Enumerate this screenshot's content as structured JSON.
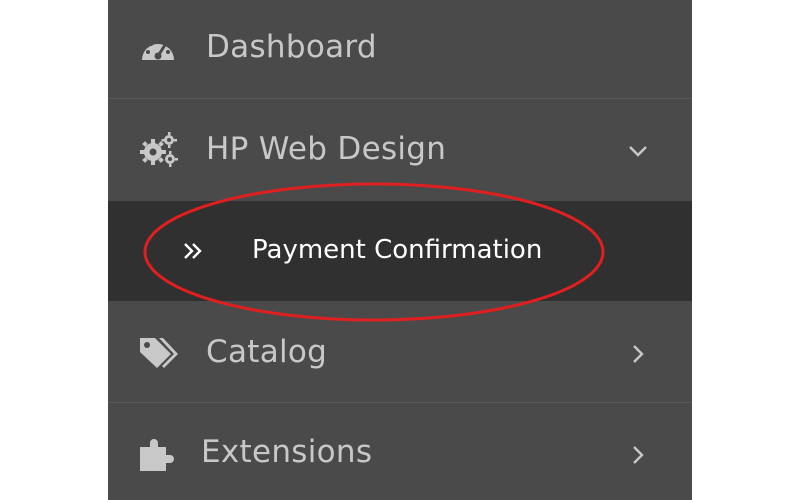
{
  "sidebar": {
    "items": [
      {
        "label": "Dashboard",
        "icon": "dashboard-gauge-icon",
        "expandable": false
      },
      {
        "label": "HP Web Design",
        "icon": "cogs-icon",
        "expandable": true,
        "expanded": true
      },
      {
        "label": "Payment Confirmation",
        "icon": "double-chevron-right-icon",
        "submenu": true,
        "active": true
      },
      {
        "label": "Catalog",
        "icon": "tags-icon",
        "expandable": true,
        "expanded": false
      },
      {
        "label": "Extensions",
        "icon": "puzzle-piece-icon",
        "expandable": true,
        "expanded": false
      }
    ]
  },
  "colors": {
    "sidebar_bg": "#4a4a4a",
    "submenu_active_bg": "#303030",
    "text_muted": "#c8c8c8",
    "text_active": "#ffffff",
    "annotation_ellipse": "#e02020"
  }
}
